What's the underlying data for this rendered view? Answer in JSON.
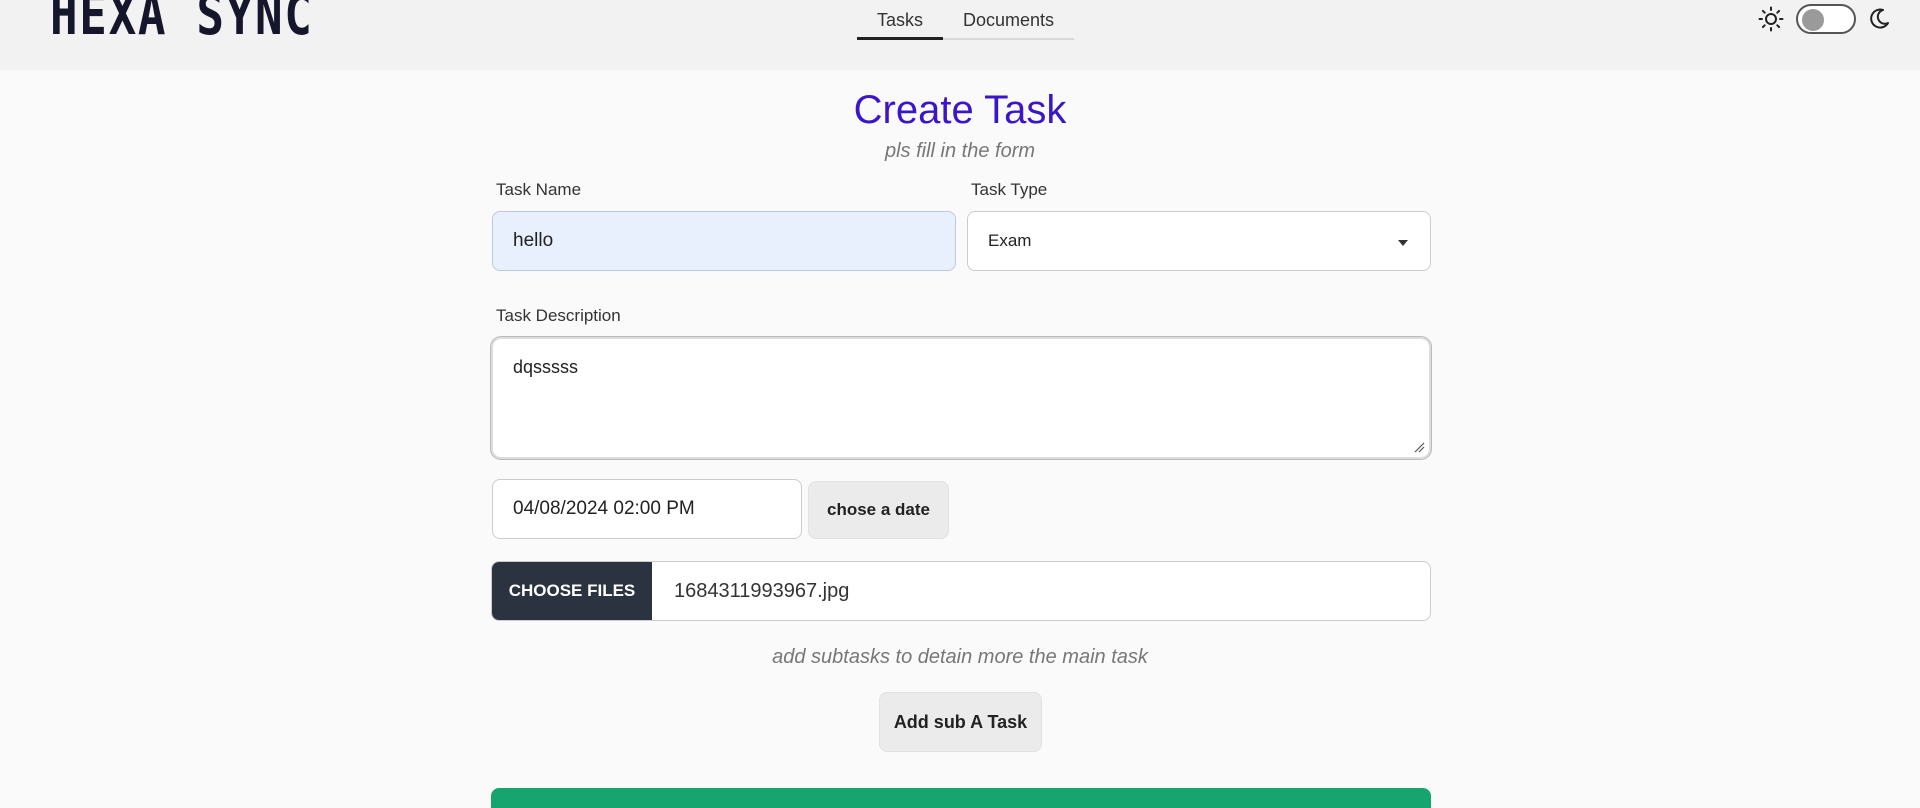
{
  "header": {
    "logo_text": "HEXA SYNC",
    "tabs": [
      {
        "label": "Tasks",
        "active": true
      },
      {
        "label": "Documents",
        "active": false
      }
    ],
    "theme_toggle": {
      "icons": [
        "sun-icon",
        "moon-icon"
      ],
      "dark_mode": false
    }
  },
  "form": {
    "title": "Create Task",
    "subtitle": "pls fill in the form",
    "task_name": {
      "label": "Task Name",
      "value": "hello"
    },
    "task_type": {
      "label": "Task Type",
      "value": "Exam"
    },
    "task_description": {
      "label": "Task Description",
      "value": "dqsssss"
    },
    "date": {
      "value": "04/08/2024  02:00  PM",
      "button_label": "chose a date"
    },
    "file": {
      "button_label": "CHOOSE FILES",
      "file_name": "1684311993967.jpg"
    },
    "subtasks_hint": "add subtasks to detain more the main task",
    "add_subtask_label": "Add sub A Task"
  },
  "colors": {
    "title": "#3b16c9",
    "file_button": "#2b3340",
    "submit": "#16a56e",
    "task_name_bg": "#e8f0fe"
  }
}
